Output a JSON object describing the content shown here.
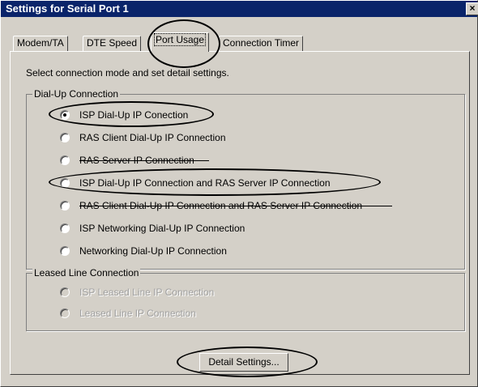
{
  "window": {
    "title": "Settings for Serial Port 1",
    "close_glyph": "×"
  },
  "tabs": [
    {
      "label": "Modem/TA"
    },
    {
      "label": "DTE Speed"
    },
    {
      "label": "Port Usage",
      "active": true
    },
    {
      "label": "Connection Timer"
    }
  ],
  "instructions": "Select connection mode and set detail settings.",
  "dialup": {
    "legend": "Dial-Up Connection",
    "options": [
      {
        "label": "ISP Dial-Up IP Conection",
        "checked": true
      },
      {
        "label": "RAS Client Dial-Up IP Connection"
      },
      {
        "label": "RAS Server IP Connection"
      },
      {
        "label": "ISP Dial-Up IP Connection and RAS Server IP Connection"
      },
      {
        "label": "RAS Client Dial-Up IP Connection and RAS Server IP Connection"
      },
      {
        "label": "ISP Networking Dial-Up IP Connection"
      },
      {
        "label": "Networking Dial-Up IP Connection"
      }
    ]
  },
  "leased": {
    "legend": "Leased Line Connection",
    "options": [
      {
        "label": "ISP Leased Line IP Connection",
        "disabled": true
      },
      {
        "label": "Leased Line IP Connection",
        "disabled": true
      }
    ]
  },
  "detail_button": {
    "label": "Detail Settings..."
  },
  "colors": {
    "titlebar": "#0a246a",
    "face": "#d4d0c8",
    "disabled_text": "#a0a0a0"
  }
}
